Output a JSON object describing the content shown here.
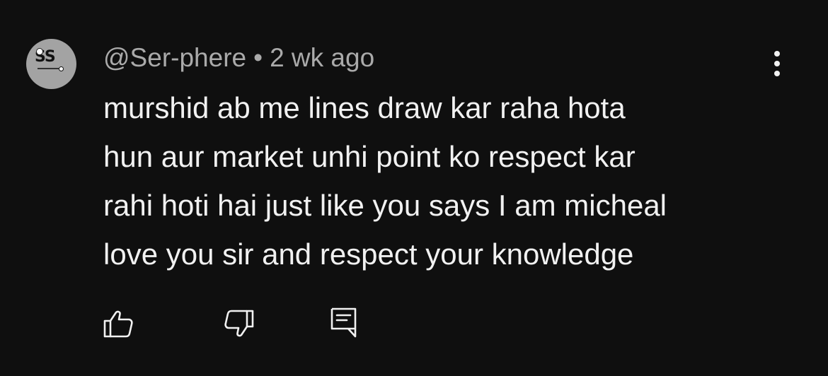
{
  "comment": {
    "author": "@Ser-phere",
    "separator": "•",
    "time_ago": "2 wk ago",
    "avatar_initials": "SS",
    "text_lines": [
      "murshid ab me lines draw kar raha hota",
      "hun aur market unhi point ko respect kar",
      "rahi hoti hai just like you says I am micheal",
      "love you sir and respect your knowledge"
    ]
  },
  "actions": {
    "like_icon": "thumbs-up-icon",
    "dislike_icon": "thumbs-down-icon",
    "reply_icon": "reply-comment-icon",
    "more_icon": "more-vertical-icon"
  },
  "colors": {
    "background": "#0f0f0f",
    "text": "#f1f1f1",
    "meta": "#aaaaaa",
    "avatar_bg": "#a3a3a3"
  }
}
